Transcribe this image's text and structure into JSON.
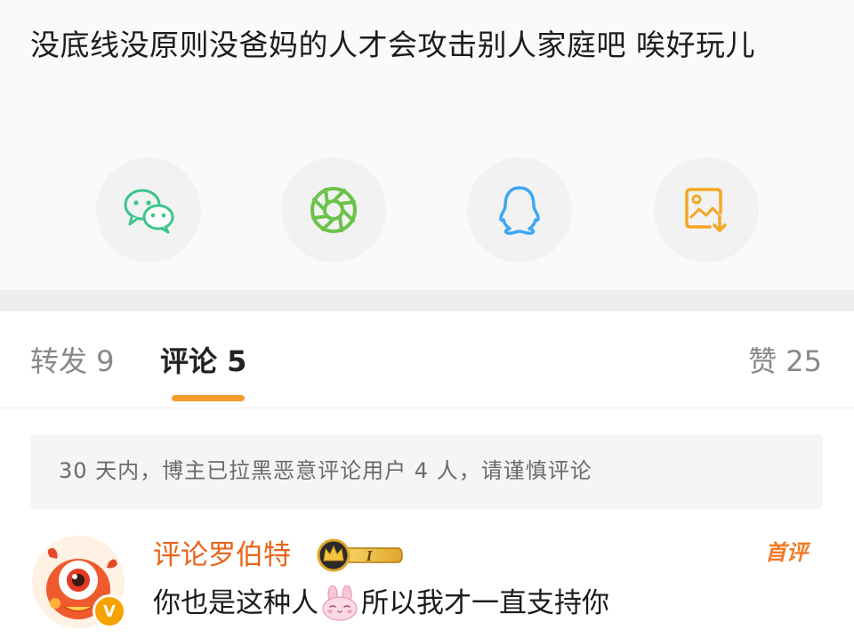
{
  "post": {
    "text": "没底线没原则没爸妈的人才会攻击别人家庭吧 唉好玩儿"
  },
  "share": [
    {
      "icon": "wechat-icon",
      "color": "#3cc48a"
    },
    {
      "icon": "moments-icon",
      "color": "#6cc24a"
    },
    {
      "icon": "qq-icon",
      "color": "#3ea7f2"
    },
    {
      "icon": "save-image-icon",
      "color": "#f5a623"
    }
  ],
  "tabs": {
    "repost": "转发 9",
    "comments": "评论 5",
    "likes": "赞 25"
  },
  "notice": {
    "text": "30 天内，博主已拉黑恶意评论用户 4 人，请谨慎评论"
  },
  "comment": {
    "username": "评论罗伯特",
    "vip_level": "I",
    "verified_badge": "V",
    "first_tag": "首评",
    "text_before": "你也是这种人",
    "emoji": "bunny-emoji",
    "text_after": "所以我才一直支持你"
  },
  "colors": {
    "accent": "#f39a2c",
    "username": "#e8641b"
  }
}
